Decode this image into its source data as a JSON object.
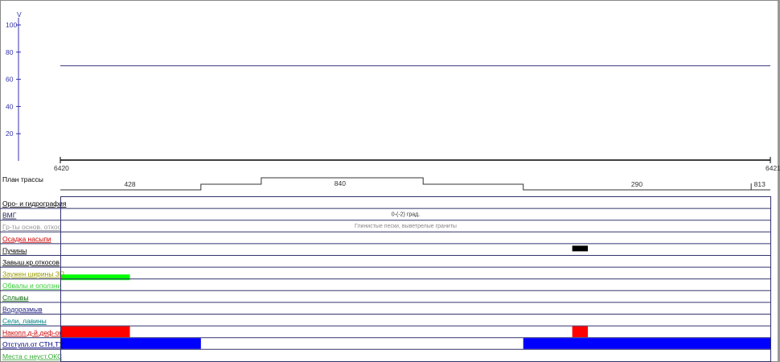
{
  "chart_data": {
    "type": "line",
    "ylabel": "V",
    "yticks": [
      20,
      40,
      60,
      80,
      100
    ],
    "ylim": [
      0,
      105
    ],
    "x_start_label": "6420",
    "x_end_label": "6421",
    "series": [
      {
        "name": "V",
        "values": [
          70,
          70
        ]
      }
    ],
    "line_color": "#33337f"
  },
  "plan": {
    "label": "План трассы",
    "segments": [
      {
        "from": 0,
        "to": 0.198,
        "level": 0,
        "label": ""
      },
      {
        "from": 0.198,
        "to": 0.283,
        "level": 1,
        "label": ""
      },
      {
        "from": 0.283,
        "to": 0.511,
        "level": 2,
        "label": "840"
      },
      {
        "from": 0.511,
        "to": 0.652,
        "level": 1,
        "label": ""
      },
      {
        "from": 0.652,
        "to": 1,
        "level": 0,
        "label": ""
      }
    ],
    "labels": [
      {
        "text": "428",
        "pos": 0.098
      },
      {
        "text": "840",
        "pos": 0.394
      },
      {
        "text": "290",
        "pos": 0.812
      },
      {
        "text": "813",
        "pos": 0.985
      }
    ],
    "tick_pos": 0.973
  },
  "rows": [
    {
      "label": "Оро- и гидрография",
      "color": "#000000",
      "text": "",
      "bars": []
    },
    {
      "label": "ВМГ",
      "color": "#1a1a4d",
      "text": "0-(-2) град.",
      "bars": []
    },
    {
      "label": "Гр-ты основ. откос",
      "color": "#999999",
      "text": "Глинистые пески, выветрелые граниты",
      "bars": []
    },
    {
      "label": "Осадка насыпи",
      "color": "#cc0000",
      "text": "",
      "bars": []
    },
    {
      "label": "Пучины",
      "color": "#000000",
      "text": "",
      "bars": [
        {
          "from": 0.721,
          "to": 0.743,
          "color": "#000000",
          "part": "mid"
        }
      ]
    },
    {
      "label": "Завыш.кр.откосов",
      "color": "#000000",
      "text": "",
      "bars": []
    },
    {
      "label": "Заужен ширины ЗП",
      "color": "#999900",
      "text": "",
      "bars": [
        {
          "from": 0,
          "to": 0.098,
          "color": "#00ff00",
          "part": "low"
        }
      ]
    },
    {
      "label": "Обвалы и оползни",
      "color": "#33cc33",
      "text": "",
      "bars": []
    },
    {
      "label": "Сплывы",
      "color": "#006600",
      "text": "",
      "bars": []
    },
    {
      "label": "Водоразмыв",
      "color": "#1a1a80",
      "text": "",
      "bars": []
    },
    {
      "label": "Сели, лавины",
      "color": "#008080",
      "text": "",
      "bars": []
    },
    {
      "label": "Накопл.д-й.деф-ов.",
      "color": "#cc0000",
      "text": "",
      "bars": [
        {
          "from": 0,
          "to": 0.098,
          "color": "#ff0000",
          "part": "full"
        },
        {
          "from": 0.721,
          "to": 0.743,
          "color": "#ff0000",
          "part": "full"
        }
      ]
    },
    {
      "label": "Отступл.от СТН,ТУ",
      "color": "#000080",
      "text": "",
      "bars": [
        {
          "from": 0,
          "to": 0.198,
          "color": "#0000ff",
          "part": "full"
        },
        {
          "from": 0.652,
          "to": 1,
          "color": "#0000ff",
          "part": "full"
        }
      ]
    },
    {
      "label": "Места с неуст.ОКС",
      "color": "#33aa33",
      "text": "",
      "bars": []
    }
  ]
}
